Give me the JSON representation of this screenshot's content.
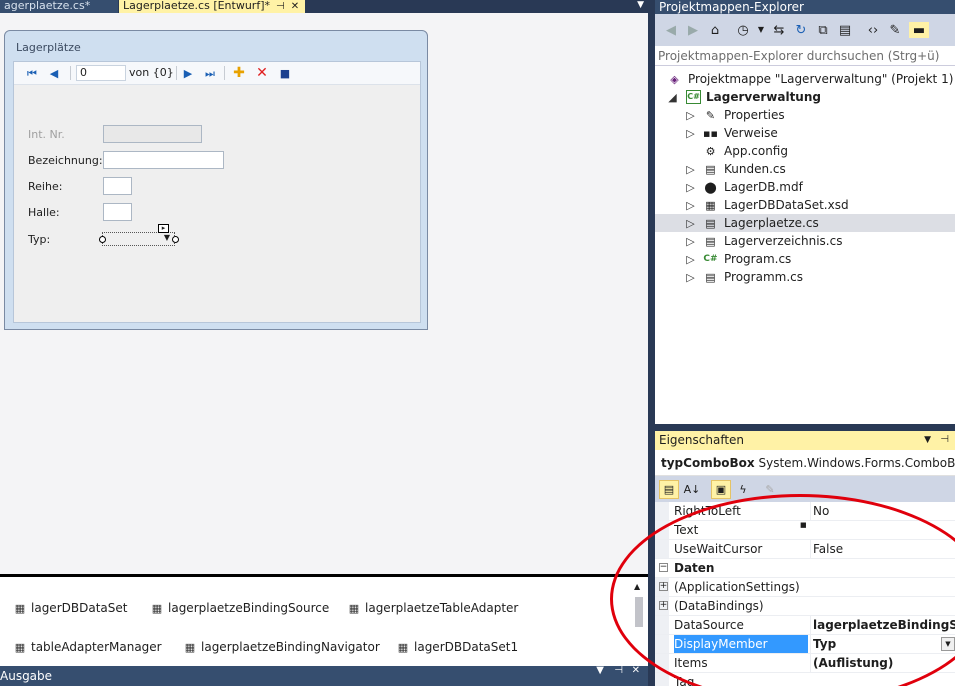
{
  "doc_tabs": [
    {
      "label": "agerplaetze.cs*"
    },
    {
      "label": "Lagerplaetze.cs [Entwurf]*"
    }
  ],
  "form": {
    "title": "Lagerplätze",
    "nav_position": "0",
    "nav_of": "von {0}",
    "fields": [
      {
        "label": "Int. Nr."
      },
      {
        "label": "Bezeichnung:"
      },
      {
        "label": "Reihe:"
      },
      {
        "label": "Halle:"
      },
      {
        "label": "Typ:"
      }
    ]
  },
  "tray": {
    "components": [
      {
        "label": "lagerDBDataSet"
      },
      {
        "label": "lagerplaetzeBindingSource"
      },
      {
        "label": "lagerplaetzeTableAdapter"
      },
      {
        "label": "tableAdapterManager"
      },
      {
        "label": "lagerplaetzeBindingNavigator"
      },
      {
        "label": "lagerDBDataSet1"
      }
    ]
  },
  "output": {
    "title": "Ausgabe"
  },
  "solution_explorer": {
    "title": "Projektmappen-Explorer",
    "search_placeholder": "Projektmappen-Explorer durchsuchen (Strg+ü)",
    "nodes": [
      {
        "label": "Projektmappe \"Lagerverwaltung\" (Projekt 1)",
        "icon": "solution-icon"
      },
      {
        "label": "Lagerverwaltung",
        "icon": "csharp-project-icon"
      },
      {
        "label": "Properties",
        "icon": "wrench-icon"
      },
      {
        "label": "Verweise",
        "icon": "references-icon"
      },
      {
        "label": "App.config",
        "icon": "config-icon"
      },
      {
        "label": "Kunden.cs",
        "icon": "form-icon"
      },
      {
        "label": "LagerDB.mdf",
        "icon": "database-icon"
      },
      {
        "label": "LagerDBDataSet.xsd",
        "icon": "dataset-icon"
      },
      {
        "label": "Lagerplaetze.cs",
        "icon": "form-icon"
      },
      {
        "label": "Lagerverzeichnis.cs",
        "icon": "form-icon"
      },
      {
        "label": "Program.cs",
        "icon": "csharp-file-icon"
      },
      {
        "label": "Programm.cs",
        "icon": "form-icon"
      }
    ]
  },
  "properties": {
    "title": "Eigenschaften",
    "object_name": "typComboBox",
    "object_type": "System.Windows.Forms.ComboBox",
    "rows": [
      {
        "name": "RightToLeft",
        "value": "No"
      },
      {
        "name": "Text",
        "value": ""
      },
      {
        "name": "UseWaitCursor",
        "value": "False"
      },
      {
        "name": "Daten",
        "value": ""
      },
      {
        "name": "(ApplicationSettings)",
        "value": ""
      },
      {
        "name": "(DataBindings)",
        "value": ""
      },
      {
        "name": "DataSource",
        "value": "lagerplaetzeBindingSource"
      },
      {
        "name": "DisplayMember",
        "value": "Typ"
      },
      {
        "name": "Items",
        "value": "(Auflistung)"
      },
      {
        "name": "Tag",
        "value": ""
      }
    ]
  },
  "colors": {
    "accent": "#fff2a6",
    "frame": "#293955",
    "annotation": "#e0000c"
  }
}
